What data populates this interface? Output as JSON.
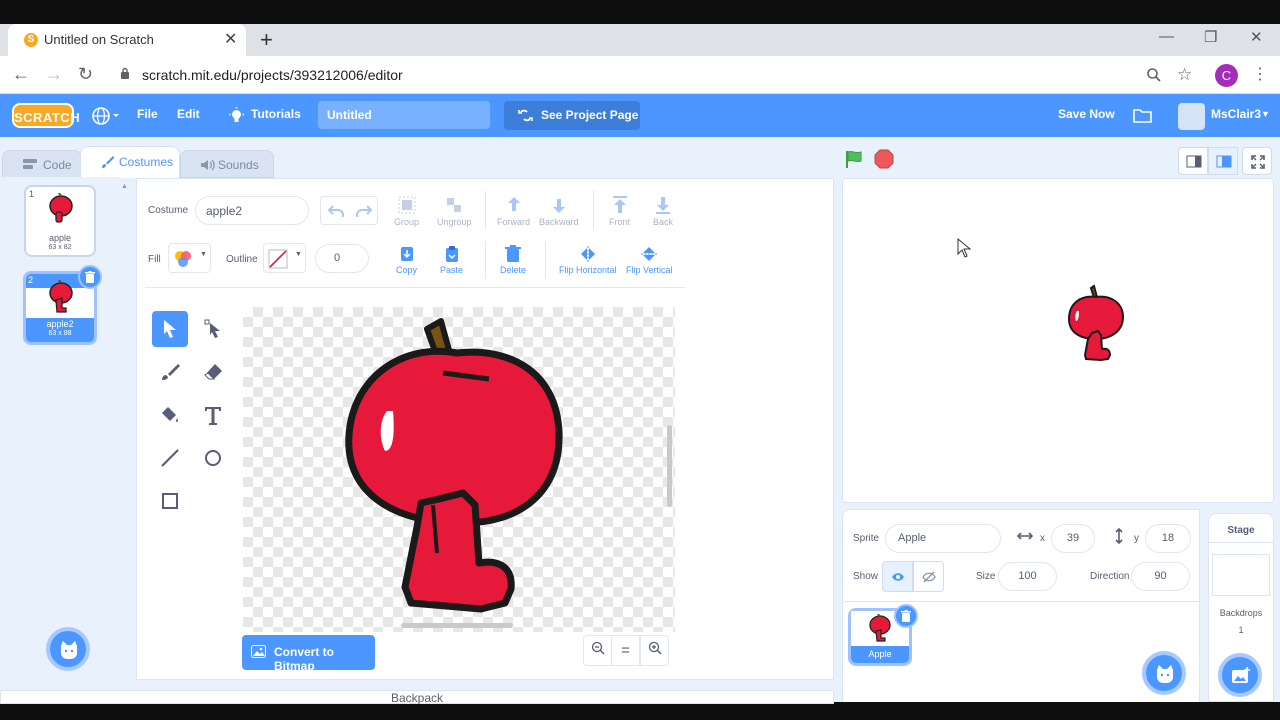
{
  "browser": {
    "tab_title": "Untitled on Scratch",
    "url_host": "scratch.mit.edu",
    "url_path": "/projects/393212006/editor",
    "profile_initial": "C",
    "new_tab": "+",
    "tab_close": "✕",
    "win_min": "—",
    "win_max": "❐",
    "win_close": "✕"
  },
  "menubar": {
    "logo": "SCRATCH",
    "file": "File",
    "edit": "Edit",
    "tutorials": "Tutorials",
    "project_title": "Untitled",
    "see_project": "See Project Page",
    "save_now": "Save Now",
    "username": "MsClair3"
  },
  "editor_tabs": {
    "code": "Code",
    "costumes": "Costumes",
    "sounds": "Sounds"
  },
  "costumes": [
    {
      "index": "1",
      "name": "apple",
      "size": "63 x 82"
    },
    {
      "index": "2",
      "name": "apple2",
      "size": "63 x 88"
    }
  ],
  "paint": {
    "costume_label": "Costume",
    "costume_name": "apple2",
    "fill_label": "Fill",
    "outline_label": "Outline",
    "outline_width": "0",
    "group": "Group",
    "ungroup": "Ungroup",
    "forward": "Forward",
    "backward": "Backward",
    "front": "Front",
    "back": "Back",
    "copy": "Copy",
    "paste": "Paste",
    "delete": "Delete",
    "flip_h": "Flip Horizontal",
    "flip_v": "Flip Vertical",
    "convert": "Convert to Bitmap",
    "zoom_out": "−",
    "zoom_reset": "=",
    "zoom_in": "+"
  },
  "sprite": {
    "label": "Sprite",
    "name": "Apple",
    "x_label": "x",
    "x": "39",
    "y_label": "y",
    "y": "18",
    "show_label": "Show",
    "size_label": "Size",
    "size": "100",
    "direction_label": "Direction",
    "direction": "90"
  },
  "sprite_list": [
    {
      "name": "Apple"
    }
  ],
  "stage_pane": {
    "title": "Stage",
    "backdrops_label": "Backdrops",
    "backdrops_count": "1"
  },
  "backpack": "Backpack",
  "colors": {
    "scratch_blue": "#4c97ff",
    "apple_red": "#e6193a",
    "flag_green": "#4cbf56",
    "stop_red": "#ec5959"
  }
}
